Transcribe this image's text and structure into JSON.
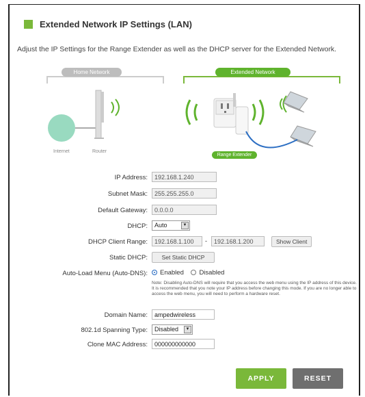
{
  "header": {
    "title": "Extended Network IP Settings (LAN)"
  },
  "intro": "Adjust the IP Settings for the Range Extender as well as the DHCP server for the Extended Network.",
  "diagram": {
    "home_label": "Home Network",
    "ext_label": "Extended Network",
    "internet_label": "Internet",
    "router_label": "Router",
    "extender_label": "Range Extender"
  },
  "form": {
    "ip_address": {
      "label": "IP Address:",
      "value": "192.168.1.240"
    },
    "subnet_mask": {
      "label": "Subnet Mask:",
      "value": "255.255.255.0"
    },
    "default_gateway": {
      "label": "Default Gateway:",
      "value": "0.0.0.0"
    },
    "dhcp": {
      "label": "DHCP:",
      "value": "Auto"
    },
    "dhcp_range": {
      "label": "DHCP Client Range:",
      "start": "192.168.1.100",
      "sep": "-",
      "end": "192.168.1.200",
      "button": "Show Client"
    },
    "static_dhcp": {
      "label": "Static DHCP:",
      "button": "Set Static DHCP"
    },
    "auto_dns": {
      "label": "Auto-Load Menu (Auto-DNS):",
      "enabled": "Enabled",
      "disabled": "Disabled",
      "note": "Note: Disabling Auto-DNS will require that you access the web menu using the IP address of this device. It is recommended that you note your IP address before changing this mode. If you are no longer able to access the web menu, you will need to perform a hardware reset."
    },
    "domain_name": {
      "label": "Domain Name:",
      "value": "ampedwireless"
    },
    "spanning_tree": {
      "label": "802.1d Spanning Type:",
      "value": "Disabled"
    },
    "clone_mac": {
      "label": "Clone MAC Address:",
      "value": "000000000000"
    }
  },
  "actions": {
    "apply": "APPLY",
    "reset": "RESET"
  },
  "colors": {
    "accent": "#7ab83a",
    "reset": "#6f6f6f",
    "home_pill": "#bdbdbd",
    "internet_globe": "#7fd1b0"
  }
}
